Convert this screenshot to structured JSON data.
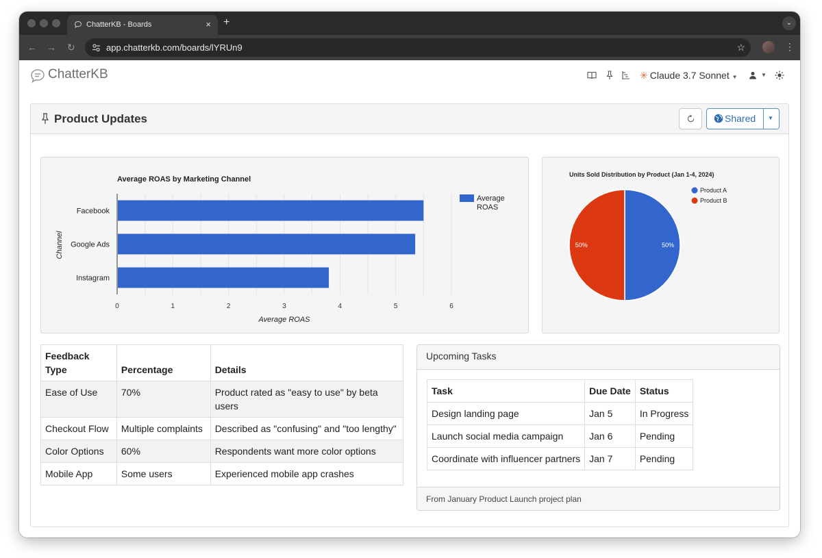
{
  "browser": {
    "tab_title": "ChatterKB - Boards",
    "url": "app.chatterkb.com/boards/lYRUn9"
  },
  "header": {
    "logo_text": "ChatterKB",
    "model_label": "Claude 3.7 Sonnet",
    "icons": [
      "book-icon",
      "pin-icon",
      "flow-icon",
      "user-icon",
      "sun-icon"
    ]
  },
  "board": {
    "title": "Product Updates",
    "shared_label": "Shared"
  },
  "chart_data": [
    {
      "type": "bar",
      "orientation": "horizontal",
      "title": "Average ROAS by Marketing Channel",
      "xlabel": "Average ROAS",
      "ylabel": "Channel",
      "categories": [
        "Facebook",
        "Google Ads",
        "Instagram"
      ],
      "series": [
        {
          "name": "Average ROAS",
          "values": [
            5.5,
            5.35,
            3.8
          ]
        }
      ],
      "xlim": [
        0,
        6
      ],
      "xticks": [
        "0",
        "1",
        "2",
        "3",
        "4",
        "5",
        "6"
      ],
      "legend_position": "right",
      "grid": true,
      "color": "#3366cc"
    },
    {
      "type": "pie",
      "title": "Units Sold Distribution by Product (Jan 1-4, 2024)",
      "categories": [
        "Product A",
        "Product B"
      ],
      "values": [
        50,
        50
      ],
      "labels": [
        "50%",
        "50%"
      ],
      "colors": [
        "#3366cc",
        "#dc3912"
      ],
      "legend_position": "right"
    }
  ],
  "feedback_table": {
    "headers": [
      "Feedback Type",
      "Percentage",
      "Details"
    ],
    "rows": [
      [
        "Ease of Use",
        "70%",
        "Product rated as \"easy to use\" by beta users"
      ],
      [
        "Checkout Flow",
        "Multiple complaints",
        "Described as \"confusing\" and \"too lengthy\""
      ],
      [
        "Color Options",
        "60%",
        "Respondents want more color options"
      ],
      [
        "Mobile App",
        "Some users",
        "Experienced mobile app crashes"
      ]
    ]
  },
  "tasks": {
    "title": "Upcoming Tasks",
    "headers": [
      "Task",
      "Due Date",
      "Status"
    ],
    "rows": [
      [
        "Design landing page",
        "Jan 5",
        "In Progress"
      ],
      [
        "Launch social media campaign",
        "Jan 6",
        "Pending"
      ],
      [
        "Coordinate with influencer partners",
        "Jan 7",
        "Pending"
      ]
    ],
    "footer": "From January Product Launch project plan"
  }
}
